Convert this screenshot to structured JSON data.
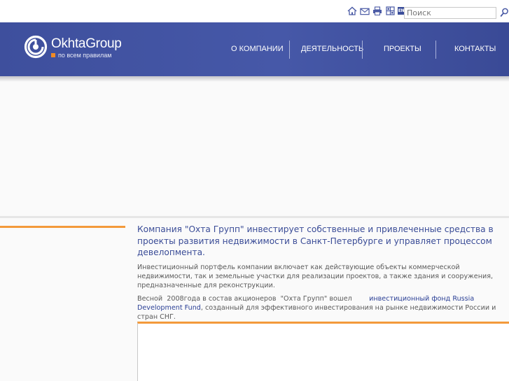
{
  "util": {
    "icons": [
      "home-icon",
      "mail-icon",
      "print-icon",
      "sitemap-icon"
    ],
    "lang_label": "ENG",
    "search_placeholder": "Поиск"
  },
  "header": {
    "brand": "OkhtaGroup",
    "slogan": "по всем правилам",
    "nav": [
      {
        "label": "О КОМПАНИИ"
      },
      {
        "label": "ДЕЯТЕЛЬНОСТЬ"
      },
      {
        "label": "ПРОЕКТЫ"
      },
      {
        "label": "КОНТАКТЫ"
      }
    ]
  },
  "content": {
    "lead": "Компания  \"Охта Групп\" инвестирует собственные и привлеченные средства в проекты развития   недвижимости в Санкт-Петербурге и управляет процессом девелопмента.",
    "para1": "Инвестиционный портфель компании включает как действующие объекты коммерческой недвижимости, так и земельные участки для реализации проектов, а также здания и сооружения, предназначенные для реконструкции.",
    "para2_before": "Весной  2008года в состав акционеров  \"Охта Групп\" вошел        ",
    "para2_link": "инвестиционный фонд  Russia Development Fund",
    "para2_after": ", созданный для эффективного инвестирования на рынке недвижимости России и стран СНГ."
  },
  "colors": {
    "header_blue": "#4253a3",
    "accent_orange": "#f39a3b",
    "lead_text": "#3a4c97"
  }
}
